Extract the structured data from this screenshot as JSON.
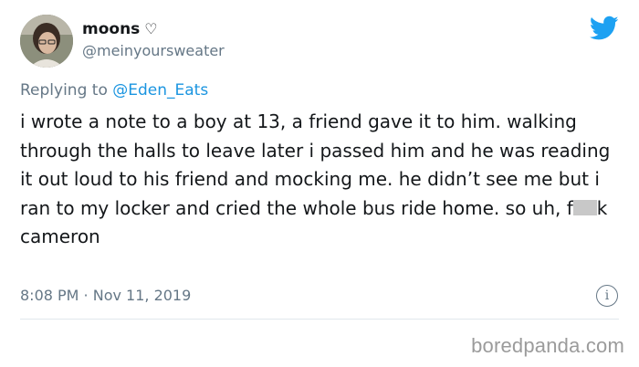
{
  "tweet": {
    "author": {
      "name": "moons",
      "name_symbol": "♡",
      "handle": "@meinyoursweater"
    },
    "reply_context": {
      "prefix": "Replying to",
      "handle": "@Eden_Eats"
    },
    "text_before_censor": "i wrote a note to a boy at 13, a friend gave it to him. walking through the halls to leave later i passed him and he was reading it out loud to his friend and mocking me. he didn’t see me but i ran to my locker and cried the whole bus ride home. so uh, f",
    "text_after_censor": "k cameron",
    "timestamp": "8:08 PM · Nov 11, 2019",
    "icons": {
      "platform": "twitter-bird-icon",
      "info": "info-icon"
    },
    "colors": {
      "link": "#1b95e0",
      "twitter_blue": "#1da1f2",
      "secondary_text": "#657786",
      "censor_bar": "#c8c8c8"
    }
  },
  "watermark": "boredpanda.com"
}
